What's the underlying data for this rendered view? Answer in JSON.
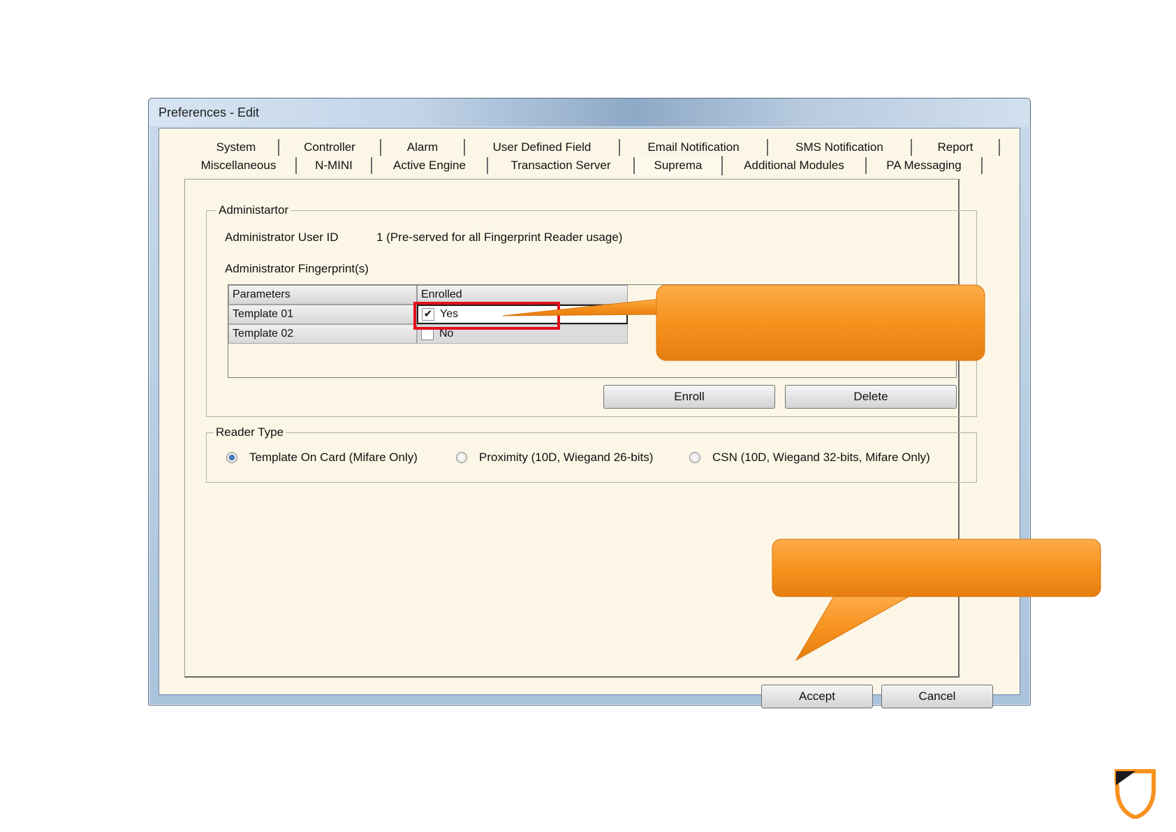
{
  "window": {
    "title": "Preferences - Edit"
  },
  "tabs": {
    "row1": [
      "System",
      "Controller",
      "Alarm",
      "User Defined Field",
      "Email Notification",
      "SMS Notification",
      "Report"
    ],
    "row2": [
      "Miscellaneous",
      "N-MINI",
      "Active Engine",
      "Transaction Server",
      "Suprema",
      "Additional Modules",
      "PA Messaging"
    ],
    "active": "Suprema"
  },
  "administrator": {
    "group_title": "Administartor",
    "user_id_label": "Administrator User ID",
    "user_id_value": "1 (Pre-served for all Fingerprint Reader usage)",
    "fingerprints_label": "Administrator Fingerprint(s)",
    "grid": {
      "headers": [
        "Parameters",
        "Enrolled"
      ],
      "rows": [
        {
          "param": "Template 01",
          "enrolled": "Yes",
          "checked": true
        },
        {
          "param": "Template 02",
          "enrolled": "No",
          "checked": false
        }
      ]
    },
    "enroll_label": "Enroll",
    "delete_label": "Delete"
  },
  "reader_type": {
    "group_title": "Reader Type",
    "options": [
      {
        "label": "Template On Card (Mifare Only)",
        "selected": true
      },
      {
        "label": "Proximity (10D, Wiegand 26-bits)",
        "selected": false
      },
      {
        "label": "CSN (10D, Wiegand 32-bits, Mifare Only)",
        "selected": false
      }
    ]
  },
  "footer": {
    "accept_label": "Accept",
    "cancel_label": "Cancel"
  },
  "colors": {
    "callout": "#f7921e",
    "highlight": "#e3101c",
    "logo": "#f7921e"
  },
  "icons": {
    "checkmark": "check-icon",
    "logo": "company-logo-icon"
  }
}
